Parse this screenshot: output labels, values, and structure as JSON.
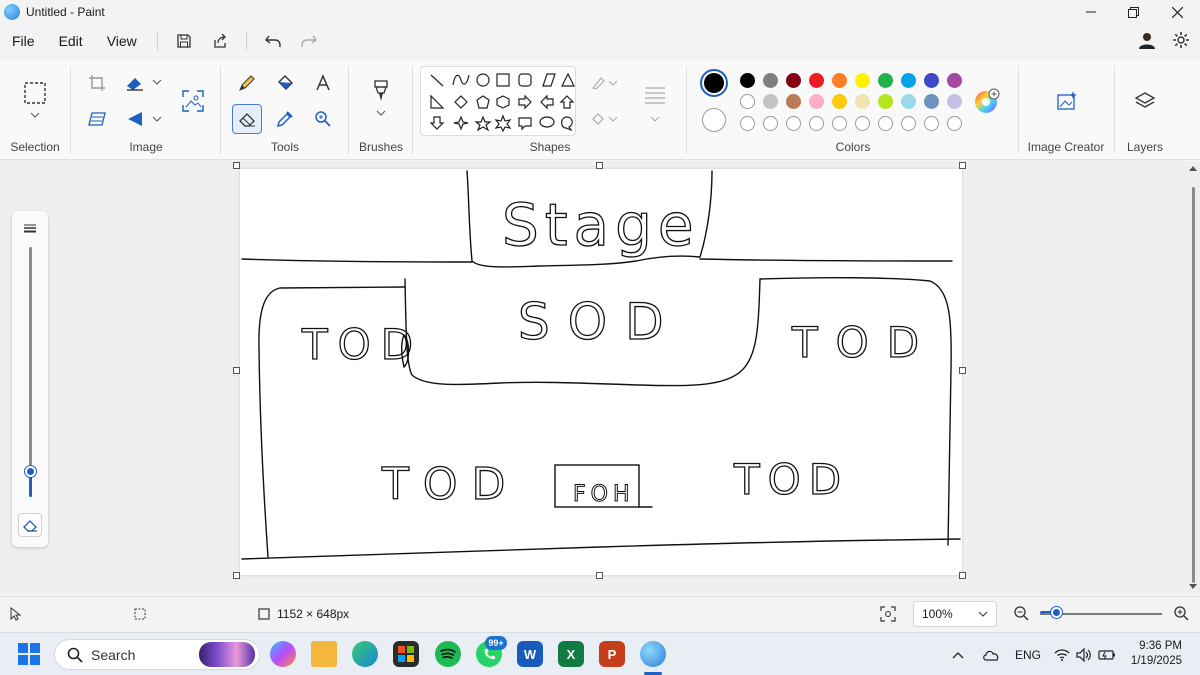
{
  "window": {
    "title": "Untitled - Paint"
  },
  "menu": {
    "file": "File",
    "edit": "Edit",
    "view": "View"
  },
  "ribbon": {
    "groups": {
      "selection": "Selection",
      "image": "Image",
      "tools": "Tools",
      "brushes": "Brushes",
      "shapes": "Shapes",
      "colors": "Colors",
      "image_creator": "Image Creator",
      "layers": "Layers"
    },
    "palette": {
      "row1": [
        "#000000",
        "#7f7f7f",
        "#880015",
        "#ed1c24",
        "#ff7f27",
        "#fff200",
        "#22b14c",
        "#00a2e8",
        "#3f48cc",
        "#a349a4"
      ],
      "row2": [
        "#ffffff",
        "#c3c3c3",
        "#b97a57",
        "#ffaec9",
        "#ffc90e",
        "#efe4b0",
        "#b5e61d",
        "#99d9ea",
        "#7092be",
        "#c8bfe7"
      ],
      "row3_empty_count": 10
    },
    "primary_color": "#000000",
    "secondary_color": "#ffffff"
  },
  "canvas": {
    "labels": {
      "stage": "Stage",
      "sod": "SOD",
      "tod_left": "TOD",
      "tod_right": "TOD",
      "tod_bottom_left": "TOD",
      "foh": "FOH",
      "tod_bottom_right": "TOD"
    }
  },
  "brush_size": {
    "level": 0.1
  },
  "status": {
    "dimensions": "1152 × 648px",
    "zoom": "100%",
    "zoom_level": 0.14
  },
  "taskbar": {
    "search_placeholder": "Search",
    "notification_badge": "99+",
    "language": "ENG",
    "time": "9:36 PM",
    "date": "1/19/2025"
  }
}
